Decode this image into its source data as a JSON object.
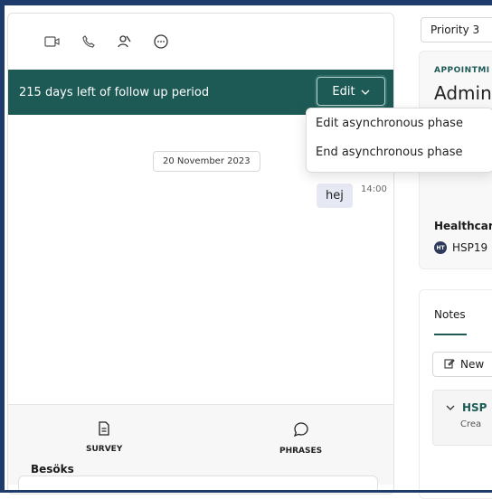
{
  "chat": {
    "toolbar_icons": [
      "video-icon",
      "phone-icon",
      "participants-icon",
      "chat-bubble-icon"
    ],
    "follow_up_text": "215 days left of follow up period",
    "edit_label": "Edit",
    "date_separator": "20 November 2023",
    "messages": [
      {
        "text": "hej",
        "time": "14:00"
      }
    ],
    "bottom": {
      "survey_label": "SURVEY",
      "phrases_label": "PHRASES"
    }
  },
  "edit_menu": {
    "options": [
      {
        "label": "Edit asynchronous phase"
      },
      {
        "label": "End asynchronous phase"
      }
    ]
  },
  "right": {
    "priority_value": "Priority 3",
    "appointment_label": "APPOINTMI",
    "appointment_title": "Admin",
    "healthcare_title": "Healthcar",
    "healthcare_badge": "HT",
    "healthcare_value": "HSP19",
    "notes_title": "Notes",
    "new_note_label": "New",
    "note_item_title": "HSP",
    "note_item_sub": "Crea",
    "besok_label": "Besöks"
  },
  "colors": {
    "brand_teal": "#1e5a55",
    "frame_blue": "#1f3b6b"
  }
}
